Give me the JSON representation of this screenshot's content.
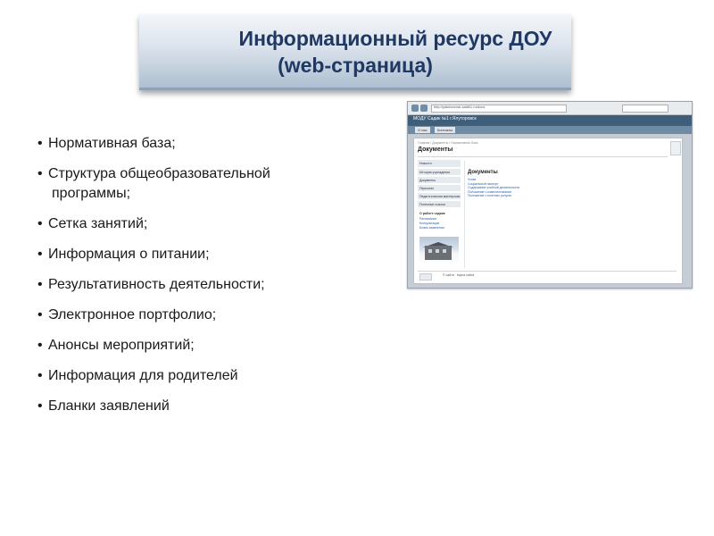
{
  "title": {
    "line1": "Информационный ресурс ДОУ",
    "line2": "(web-страница)"
  },
  "bullets": [
    "Нормативная база;",
    "Структура общеобразовательной",
    "программы;",
    "Сетка занятий;",
    "Информация о питании;",
    "Результативность деятельности;",
    "Электронное портфолио;",
    "Анонсы мероприятий;",
    "Информация для родителей",
    "Бланки заявлений"
  ],
  "bullet_glyph": "•",
  "screenshot": {
    "address": "http://yalutorovsk-sadik1.ru/docs",
    "site_title": "МОДУ Садик №1 г.Ялуторовск",
    "menu_tabs": [
      "О нас",
      "Контакты"
    ],
    "breadcrumb": "Главная / Документы / Нормативная база",
    "page_heading": "Документы",
    "sidebar_items": [
      "Новости",
      "История учреждения",
      "Документы",
      "Персонал",
      "Педагогическая мастерская",
      "Полезные ссылки"
    ],
    "sidebar_sub_heading": "О работе садика",
    "sidebar_sub_items": [
      "Расписание",
      "Консультации",
      "Бланк заявления"
    ],
    "content_title": "Документы",
    "content_links": [
      "Устав",
      "Социальный паспорт",
      "Содержание учебной деятельности",
      "Положение о комплектовании",
      "Положение о платных услугах"
    ],
    "footer_text": "© сайта · Карта сайта",
    "accent": "#3e5e7a"
  },
  "colors": {
    "title_text": "#1f3864",
    "body_text": "#1a1a1a"
  }
}
